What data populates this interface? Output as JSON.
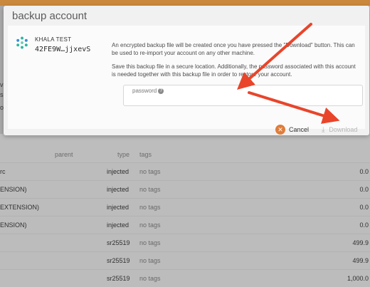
{
  "modal": {
    "title": "backup account",
    "account": {
      "name": "KHALA TEST",
      "address": "42FE9W…jjxevS",
      "icon": "account-identicon"
    },
    "description_1": "An encrypted backup file will be created once you have pressed the \"Download\" button. This can be used to re-import your account on any other machine.",
    "description_2": "Save this backup file in a secure location. Additionally, the password associated with this account is needed together with this backup file in order to restore your account.",
    "password": {
      "label": "password",
      "value": ""
    },
    "buttons": {
      "cancel": "Cancel",
      "download": "Download"
    }
  },
  "background_table": {
    "headers": {
      "parent": "parent",
      "type": "type",
      "tags": "tags"
    },
    "rows": [
      {
        "name": "rc",
        "type": "injected",
        "tags": "no tags",
        "balance": "0.0"
      },
      {
        "name": "ENSION)",
        "type": "injected",
        "tags": "no tags",
        "balance": "0.0"
      },
      {
        "name": "EXTENSION)",
        "type": "injected",
        "tags": "no tags",
        "balance": "0.0"
      },
      {
        "name": "ENSION)",
        "type": "injected",
        "tags": "no tags",
        "balance": "0.0"
      },
      {
        "name": "",
        "type": "sr25519",
        "tags": "no tags",
        "balance": "499.9"
      },
      {
        "name": "",
        "type": "sr25519",
        "tags": "no tags",
        "balance": "499.9"
      },
      {
        "name": "",
        "type": "sr25519",
        "tags": "no tags",
        "balance": "1,000.0"
      }
    ]
  },
  "left_edge_text": [
    "v",
    "s",
    "o"
  ],
  "colors": {
    "accent": "#e07d3a",
    "annotation_arrow": "#e8452b",
    "top_strip": "#c9883e"
  }
}
